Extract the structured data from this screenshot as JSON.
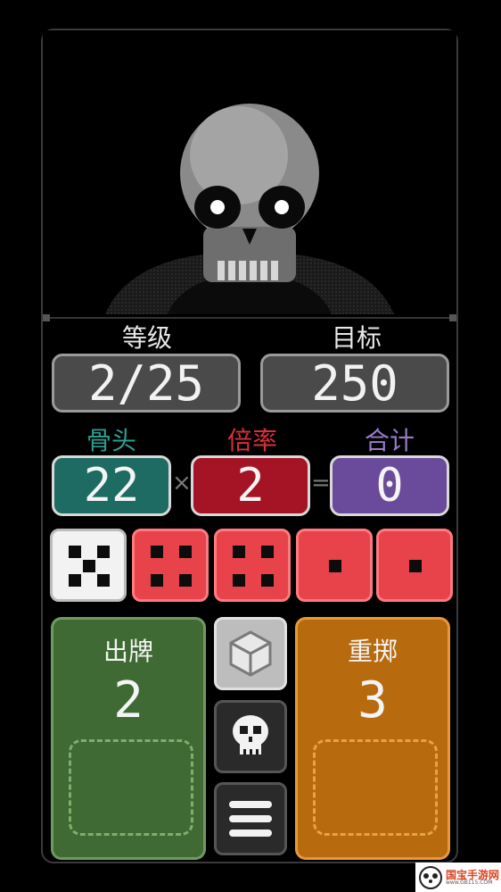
{
  "stats": {
    "level_label": "等级",
    "level_value": "2/25",
    "target_label": "目标",
    "target_value": "250"
  },
  "score": {
    "bones_label": "骨头",
    "bones_value": "22",
    "mult_label": "倍率",
    "mult_value": "2",
    "total_label": "合计",
    "total_value": "0",
    "times_symbol": "×",
    "equals_symbol": "="
  },
  "dice": [
    {
      "face": 5,
      "color": "white"
    },
    {
      "face": 4,
      "color": "red"
    },
    {
      "face": 4,
      "color": "red"
    },
    {
      "face": 1,
      "color": "red"
    },
    {
      "face": 1,
      "color": "red"
    }
  ],
  "play_pile": {
    "label": "出牌",
    "count": "2",
    "color": "#3f6a34"
  },
  "reroll_pile": {
    "label": "重掷",
    "count": "3",
    "color": "#b86a0e"
  },
  "colors": {
    "bones": "#1e6b63",
    "mult": "#a51425",
    "total": "#6a4a9a",
    "die_red": "#e8424a",
    "die_white": "#f2f2f2"
  },
  "side_icons": [
    "cube-icon",
    "skull-icon",
    "menu-icon"
  ],
  "watermark": {
    "text": "国宝手游网",
    "sub": "www.GB115.COM"
  }
}
